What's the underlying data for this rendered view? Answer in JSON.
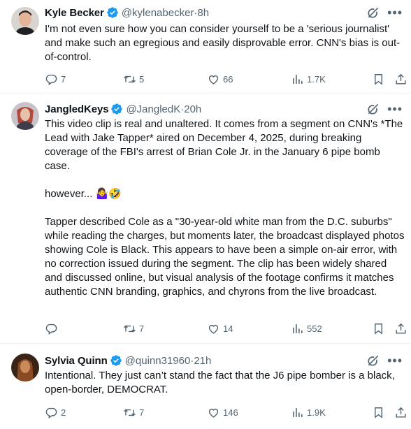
{
  "tweets": [
    {
      "name": "Kyle Becker",
      "handle": "@kylenabecker",
      "time": "8h",
      "paragraphs": [
        "I'm not even sure how you can consider yourself to be a 'serious journalist' and make such an egregious and easily disprovable error. CNN's bias is out-of-control."
      ],
      "replies": "7",
      "reposts": "5",
      "likes": "66",
      "views": "1.7K"
    },
    {
      "name": "JangledKeys",
      "handle": "@JangledK",
      "time": "20h",
      "paragraphs": [
        "This video clip is real and unaltered. It comes from a segment on CNN's *The Lead with Jake Tapper* aired on December 4, 2025, during breaking coverage of the FBI's arrest of Brian Cole Jr. in the January 6 pipe bomb case.",
        "however... 🤷‍♀️🤣",
        "Tapper described Cole as a \"30-year-old white man from the D.C. suburbs\" while reading the charges, but moments later, the broadcast displayed photos showing Cole is Black. This appears to have been a simple on-air error, with no correction issued during the segment. The clip has been widely shared and discussed online, but visual analysis of the footage confirms it matches authentic CNN branding, graphics, and chyrons from the live broadcast."
      ],
      "replies": "",
      "reposts": "7",
      "likes": "14",
      "views": "552"
    },
    {
      "name": "Sylvia Quinn",
      "handle": "@quinn31960",
      "time": "21h",
      "paragraphs": [
        "Intentional. They just can’t stand the fact that the J6 pipe bomber is a black, open-border, DEMOCRAT."
      ],
      "replies": "2",
      "reposts": "7",
      "likes": "146",
      "views": "1.9K"
    }
  ],
  "separator": " · ",
  "colors": {
    "verified": "#1d9bf0",
    "muted": "#536471",
    "text": "#0f1419",
    "divider": "#eff3f4"
  },
  "icons": [
    "verified-badge-icon",
    "grok-icon",
    "more-icon",
    "reply-icon",
    "repost-icon",
    "like-icon",
    "views-icon",
    "bookmark-icon",
    "share-icon"
  ]
}
